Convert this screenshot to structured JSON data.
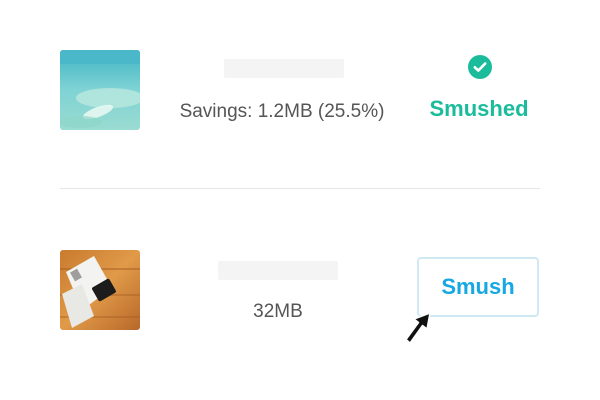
{
  "rows": [
    {
      "image": "beach-aerial-photo",
      "savings_text": "Savings: 1.2MB (25.5%)",
      "status_icon": "check-circle-icon",
      "status_label": "Smushed"
    },
    {
      "image": "desk-with-notebook-photo",
      "size_text": "32MB",
      "action_label": "Smush"
    }
  ],
  "colors": {
    "success": "#1abc9c",
    "action": "#17a8e3",
    "button_border": "#cfe9f2"
  }
}
